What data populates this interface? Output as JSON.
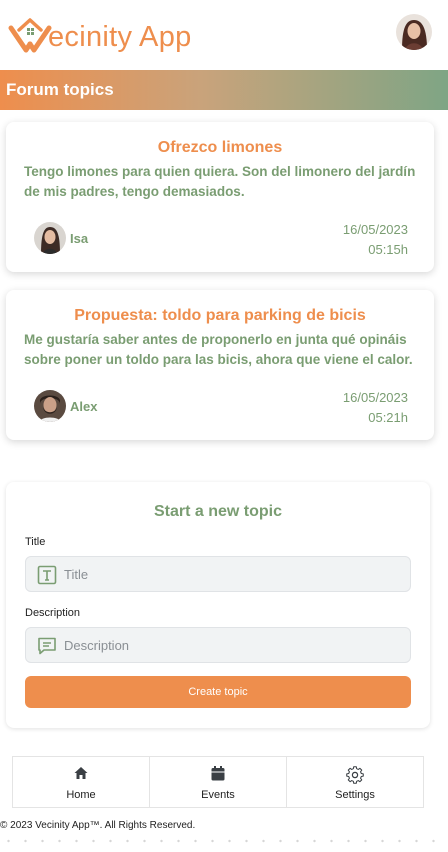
{
  "app": {
    "name": "Vecinity App",
    "logo_letter": "ecinity App"
  },
  "section": {
    "title": "Forum topics"
  },
  "topics": [
    {
      "title": "Ofrezco limones",
      "body": "Tengo limones para quien quiera. Son del limonero del jardín de mis padres, tengo demasiados.",
      "author": "Isa",
      "date": "16/05/2023",
      "time": "05:15h"
    },
    {
      "title": "Propuesta: toldo para parking de bicis",
      "body": "Me gustaría saber antes de proponerlo en junta qué opináis sobre poner un toldo para las bicis, ahora que viene el calor.",
      "author": "Alex",
      "date": "16/05/2023",
      "time": "05:21h"
    }
  ],
  "new_topic": {
    "heading": "Start a new topic",
    "title_label": "Title",
    "title_placeholder": "Title",
    "title_value": "",
    "description_label": "Description",
    "description_placeholder": "Description",
    "description_value": "",
    "submit_label": "Create topic"
  },
  "nav": [
    {
      "label": "Home",
      "icon": "home-icon"
    },
    {
      "label": "Events",
      "icon": "calendar-icon"
    },
    {
      "label": "Settings",
      "icon": "gear-icon"
    }
  ],
  "footer": {
    "text": "© 2023 Vecinity App™. All Rights Reserved."
  },
  "colors": {
    "accent": "#ee8e4d",
    "green": "#7a9d72"
  }
}
